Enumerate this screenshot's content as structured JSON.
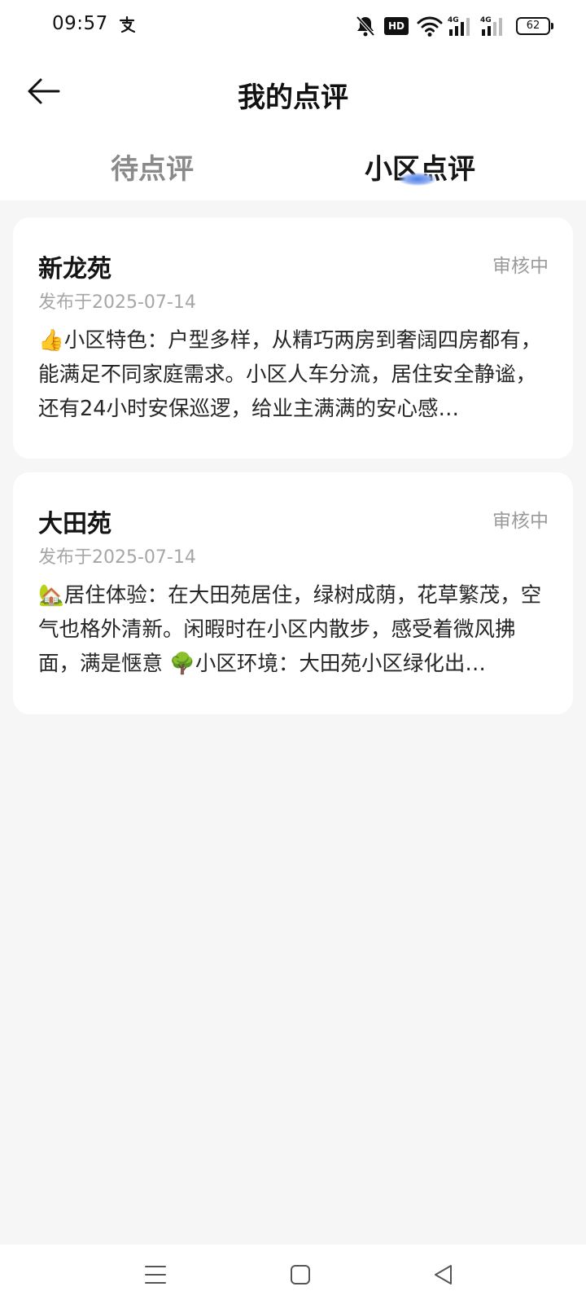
{
  "status_bar": {
    "time": "09:57",
    "hd_label": "HD",
    "battery": "62",
    "icons": [
      "alipay-icon",
      "bell-muted-icon",
      "hd-icon",
      "wifi-icon",
      "signal-4g-icon",
      "signal-4g-icon",
      "battery-icon"
    ]
  },
  "header": {
    "title": "我的点评",
    "back_icon": "arrow-left-icon"
  },
  "tabs": [
    {
      "label": "待点评",
      "active": false
    },
    {
      "label": "小区点评",
      "active": true
    }
  ],
  "colors": {
    "accent": "#4f7fe8",
    "background": "#f6f6f6",
    "card": "#ffffff",
    "muted_text": "#9a9a9a"
  },
  "reviews": [
    {
      "name": "新龙苑",
      "status": "审核中",
      "date": "发布于2025-07-14",
      "content": "👍小区特色：户型多样，从精巧两房到奢阔四房都有，能满足不同家庭需求。小区人车分流，居住安全静谧，还有24小时安保巡逻，给业主满满的安心感…"
    },
    {
      "name": "大田苑",
      "status": "审核中",
      "date": "发布于2025-07-14",
      "content": "🏡居住体验：在大田苑居住，绿树成荫，花草繁茂，空气也格外清新。闲暇时在小区内散步，感受着微风拂面，满是惬意 🌳小区环境：大田苑小区绿化出…"
    }
  ],
  "nav_bar": {
    "icons": [
      "menu-icon",
      "home-square-icon",
      "back-triangle-icon"
    ]
  }
}
